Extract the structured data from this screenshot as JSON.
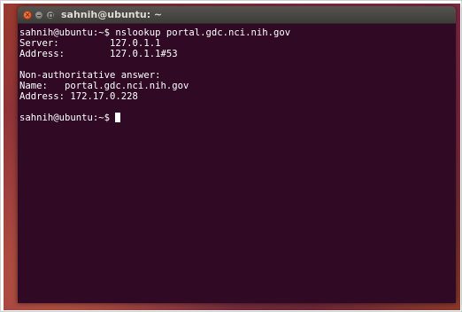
{
  "window": {
    "title": "sahnih@ubuntu: ~",
    "close_glyph": "×"
  },
  "terminal": {
    "lines": [
      "sahnih@ubuntu:~$ nslookup portal.gdc.nci.nih.gov",
      "Server:         127.0.1.1",
      "Address:        127.0.1.1#53",
      "",
      "Non-authoritative answer:",
      "Name:   portal.gdc.nci.nih.gov",
      "Address: 172.17.0.228",
      ""
    ],
    "prompt": "sahnih@ubuntu:~$ "
  },
  "colors": {
    "terminal_background": "#300a24",
    "terminal_text": "#ffffff",
    "titlebar": "#3d3c38",
    "close_button": "#df4a16"
  },
  "icons": {
    "close": "close-icon",
    "minimize": "minimize-icon",
    "maximize": "maximize-icon"
  }
}
